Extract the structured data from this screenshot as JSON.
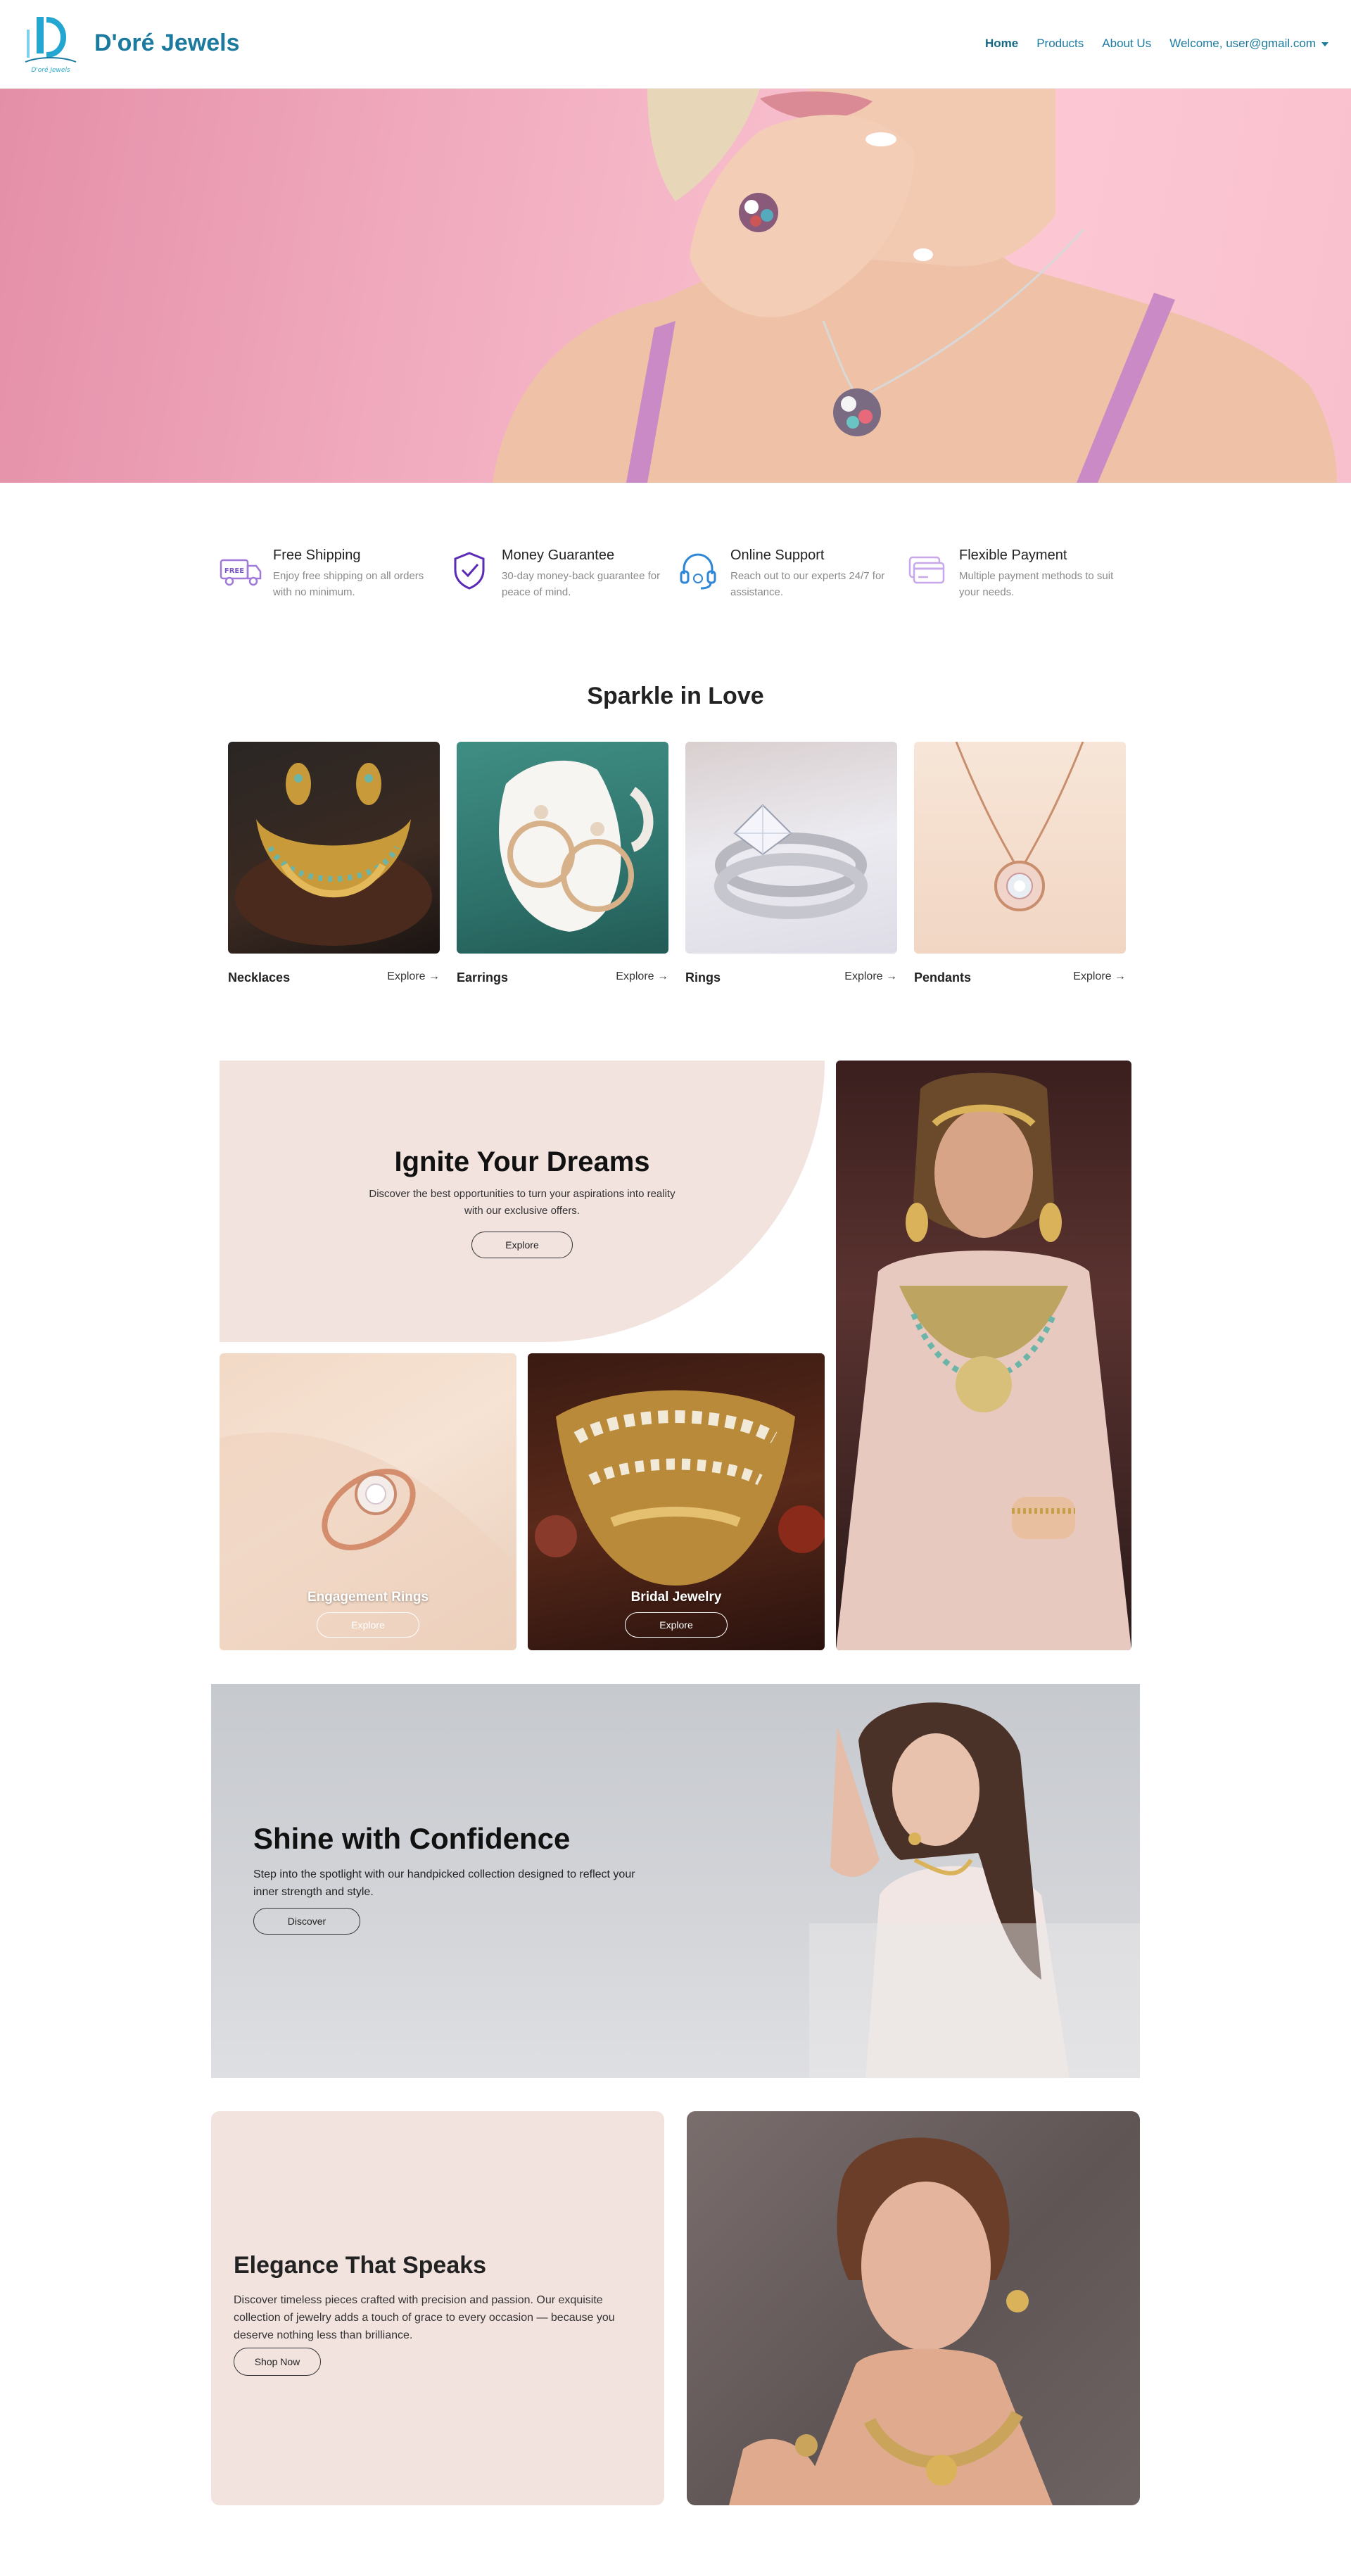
{
  "navbar": {
    "brand": "D'oré Jewels",
    "logo_text": "D'oré Jewels",
    "links": [
      "Home",
      "Products",
      "About Us"
    ],
    "user_menu": "Welcome, user@gmail.com",
    "accent": "#1c7a9e"
  },
  "features": [
    {
      "icon": "free-shipping-truck-icon",
      "title": "Free Shipping",
      "desc": "Enjoy free shipping on all orders with no minimum.",
      "badge": "FREE"
    },
    {
      "icon": "shield-check-icon",
      "title": "Money Guarantee",
      "desc": "30-day money-back guarantee for peace of mind."
    },
    {
      "icon": "headset-support-icon",
      "title": "Online Support",
      "desc": "Reach out to our experts 24/7 for assistance."
    },
    {
      "icon": "credit-card-icon",
      "title": "Flexible Payment",
      "desc": "Multiple payment methods to suit your needs."
    }
  ],
  "sparkle": {
    "title": "Sparkle in Love",
    "categories": [
      {
        "name": "Necklaces",
        "link": "Explore →"
      },
      {
        "name": "Earrings",
        "link": "Explore →"
      },
      {
        "name": "Rings",
        "link": "Explore →"
      },
      {
        "name": "Pendants",
        "link": "Explore →"
      }
    ]
  },
  "ignite": {
    "title": "Ignite Your Dreams",
    "desc": "Discover the best opportunities to turn your aspirations into reality with our exclusive offers.",
    "button": "Explore",
    "tiles": [
      {
        "label": "Engagement Rings",
        "button": "Explore"
      },
      {
        "label": "Bridal Jewelry",
        "button": "Explore"
      }
    ]
  },
  "shine": {
    "title": "Shine with Confidence",
    "desc": "Step into the spotlight with our handpicked collection designed to reflect your inner strength and style.",
    "button": "Discover"
  },
  "elegance": {
    "title": "Elegance That Speaks",
    "desc": "Discover timeless pieces crafted with precision and passion. Our exquisite collection of jewelry adds a touch of grace to every occasion — because you deserve nothing less than brilliance.",
    "button": "Shop Now"
  }
}
